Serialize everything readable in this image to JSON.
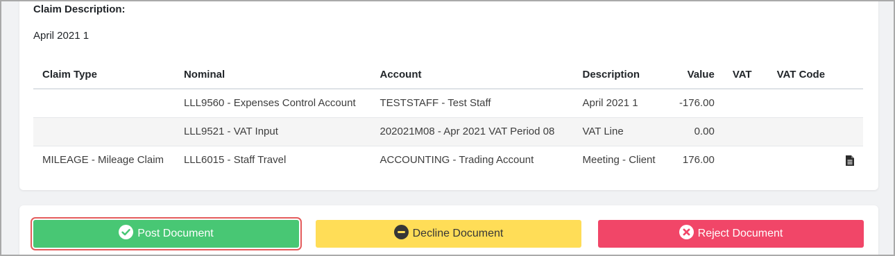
{
  "claim": {
    "description_label": "Claim Description:",
    "description_value": "April 2021 1"
  },
  "table": {
    "headers": {
      "claim_type": "Claim Type",
      "nominal": "Nominal",
      "account": "Account",
      "description": "Description",
      "value": "Value",
      "vat": "VAT",
      "vat_code": "VAT Code"
    },
    "rows": [
      {
        "claim_type": "",
        "nominal": "LLL9560 - Expenses Control Account",
        "account": "TESTSTAFF - Test Staff",
        "description": "April 2021 1",
        "value": "-176.00",
        "vat": "",
        "vat_code": "",
        "has_document_icon": false
      },
      {
        "claim_type": "",
        "nominal": "LLL9521 - VAT Input",
        "account": "202021M08 - Apr 2021 VAT Period 08",
        "description": "VAT Line",
        "value": "0.00",
        "vat": "",
        "vat_code": "",
        "has_document_icon": false
      },
      {
        "claim_type": "MILEAGE - Mileage Claim",
        "nominal": "LLL6015 - Staff Travel",
        "account": "ACCOUNTING - Trading Account",
        "description": "Meeting - Client",
        "value": "176.00",
        "vat": "",
        "vat_code": "",
        "has_document_icon": true,
        "icon": "document-icon"
      }
    ]
  },
  "actions": {
    "post": {
      "label": "Post Document",
      "icon": "check-circle-icon",
      "color": "#48c774"
    },
    "decline": {
      "label": "Decline Document",
      "icon": "minus-circle-icon",
      "color": "#ffdd57"
    },
    "reject": {
      "label": "Reject Document",
      "icon": "x-circle-icon",
      "color": "#f14668"
    }
  }
}
